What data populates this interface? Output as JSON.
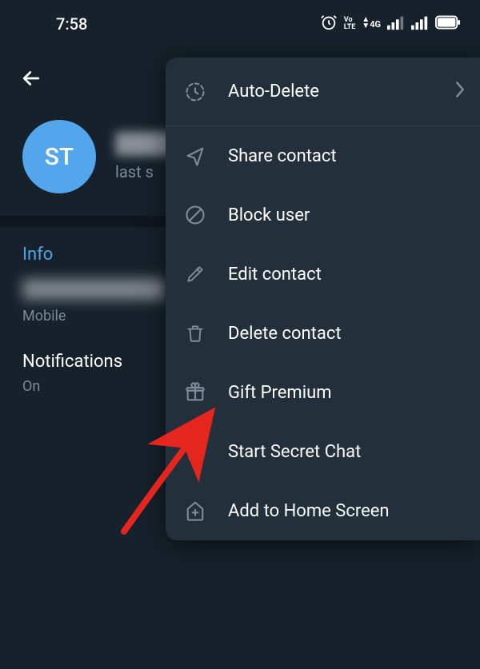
{
  "status": {
    "time": "7:58"
  },
  "profile": {
    "avatar_initials": "ST",
    "last_seen_prefix": "last s"
  },
  "info": {
    "section_label": "Info",
    "phone_label": "Mobile",
    "notifications_label": "Notifications",
    "notifications_value": "On"
  },
  "menu": {
    "auto_delete": "Auto-Delete",
    "share": "Share contact",
    "block": "Block user",
    "edit": "Edit contact",
    "delete": "Delete contact",
    "gift": "Gift Premium",
    "secret": "Start Secret Chat",
    "home": "Add to Home Screen"
  }
}
